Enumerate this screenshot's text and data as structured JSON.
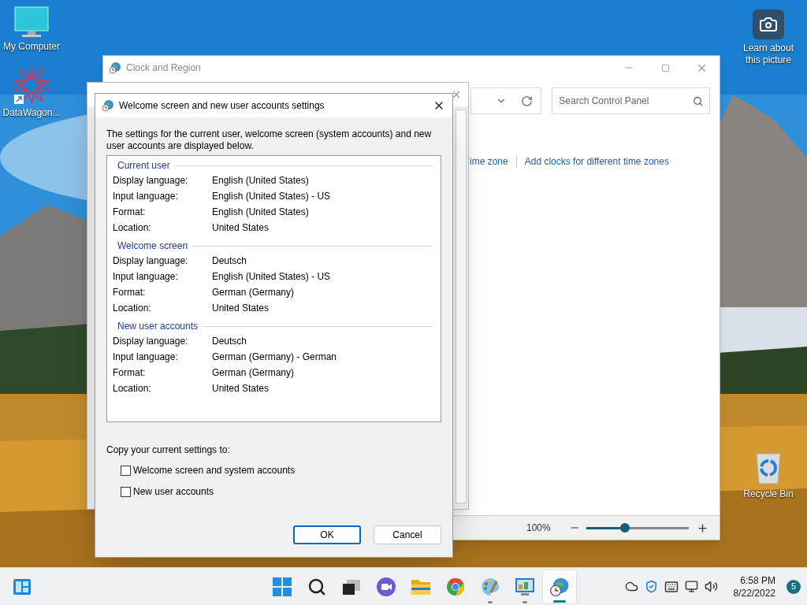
{
  "desktop_left": [
    {
      "kind": "computer",
      "label": "My Computer"
    },
    {
      "kind": "shortcut",
      "label": "DataWagon..."
    }
  ],
  "desktop_right": [
    {
      "kind": "camera",
      "label": "Learn about this picture"
    },
    {
      "kind": "recycle",
      "label": "Recycle Bin"
    }
  ],
  "clock_window": {
    "title": "Clock and Region",
    "search": {
      "placeholder": "Search Control Panel"
    },
    "links": [
      "ime zone",
      "Add clocks for different time zones"
    ],
    "zoom": {
      "reading": "100%",
      "level": 0.38
    }
  },
  "dialog": {
    "title": "Welcome screen and new user accounts settings",
    "intro": "The settings for the current user, welcome screen (system accounts) and new user accounts are displayed below.",
    "groups": [
      {
        "title": "Current user",
        "rows": [
          {
            "label": "Display language:",
            "value": "English (United States)"
          },
          {
            "label": "Input language:",
            "value": "English (United States) - US"
          },
          {
            "label": "Format:",
            "value": "English (United States)"
          },
          {
            "label": "Location:",
            "value": "United States"
          }
        ]
      },
      {
        "title": "Welcome screen",
        "rows": [
          {
            "label": "Display language:",
            "value": "Deutsch"
          },
          {
            "label": "Input language:",
            "value": "English (United States) - US"
          },
          {
            "label": "Format:",
            "value": "German (Germany)"
          },
          {
            "label": "Location:",
            "value": "United States"
          }
        ]
      },
      {
        "title": "New user accounts",
        "rows": [
          {
            "label": "Display language:",
            "value": "Deutsch"
          },
          {
            "label": "Input language:",
            "value": "German (Germany) - German"
          },
          {
            "label": "Format:",
            "value": "German (Germany)"
          },
          {
            "label": "Location:",
            "value": "United States"
          }
        ]
      }
    ],
    "copy_label": "Copy your current settings to:",
    "options": [
      {
        "label": "Welcome screen and system accounts",
        "checked": false
      },
      {
        "label": "New user accounts",
        "checked": false
      }
    ],
    "buttons": [
      {
        "label": "OK",
        "default": true
      },
      {
        "label": "Cancel",
        "default": false
      }
    ]
  },
  "taskbar": {
    "apps": [
      {
        "kind": "start",
        "running": false,
        "selected": false
      },
      {
        "kind": "search",
        "running": false,
        "selected": false
      },
      {
        "kind": "taskview",
        "running": false,
        "selected": false
      },
      {
        "kind": "chat",
        "running": false,
        "selected": false
      },
      {
        "kind": "explorer",
        "running": false,
        "selected": false
      },
      {
        "kind": "chrome",
        "running": false,
        "selected": false
      },
      {
        "kind": "paint",
        "running": true,
        "selected": false
      },
      {
        "kind": "controlpanel",
        "running": true,
        "selected": false
      },
      {
        "kind": "region",
        "running": true,
        "selected": true
      }
    ],
    "time": "6:58 PM",
    "date": "8/22/2022",
    "notifications": "5"
  }
}
